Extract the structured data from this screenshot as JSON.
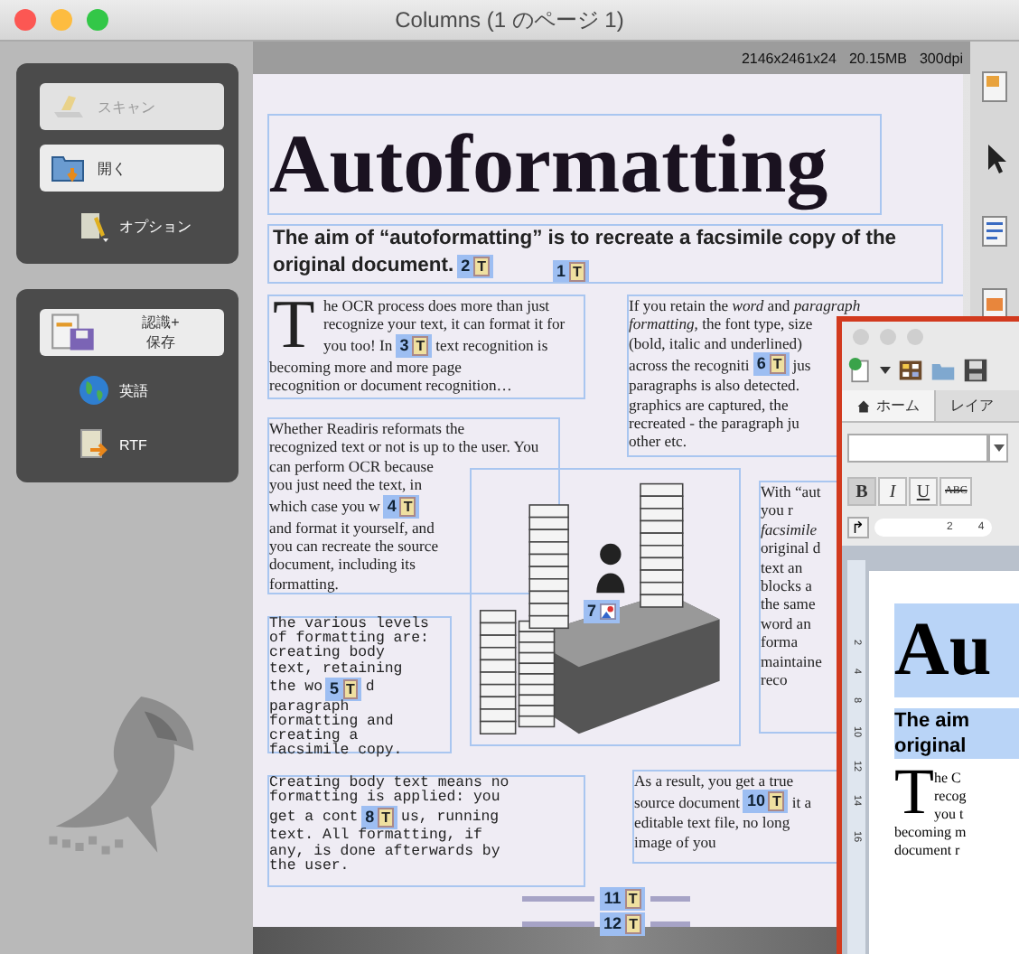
{
  "window": {
    "title": "Columns (1 のページ 1)"
  },
  "sidebar": {
    "groups": [
      {
        "items": [
          {
            "label": "スキャン",
            "kind": "button",
            "disabled": true
          },
          {
            "label": "開く",
            "kind": "button",
            "disabled": false
          },
          {
            "label": "オプション",
            "kind": "plain",
            "disabled": false
          }
        ]
      },
      {
        "items": [
          {
            "label": "認識+\n保存",
            "kind": "button",
            "disabled": false
          },
          {
            "label": "英語",
            "kind": "plain",
            "disabled": false
          },
          {
            "label": "RTF",
            "kind": "plain",
            "disabled": false
          }
        ]
      }
    ]
  },
  "status": [
    "2146x2461x24",
    "20.15MB",
    "300dpi"
  ],
  "zones": [
    {
      "kind": "heading",
      "lines": [
        {
          "text": "Autoformatting"
        }
      ],
      "label": {
        "number": "1",
        "glyph": "T"
      }
    },
    {
      "kind": "subheading",
      "lines": [
        {
          "text": "The aim of “autoformatting” is to recreate a facsimile copy of the"
        },
        {
          "text": "original document.",
          "label": true
        }
      ],
      "label": {
        "number": "2",
        "glyph": "T"
      }
    },
    {
      "kind": "paragraph",
      "dropcap": "T",
      "lines": [
        {
          "text": "he OCR process does more than just"
        },
        {
          "text": "recognize your text, it can format it for"
        },
        {
          "text": "you too! In",
          "label": true,
          "rest": "text recognition is"
        },
        {
          "text": "becoming more and more page"
        },
        {
          "text": "recognition or document recognition…"
        }
      ],
      "label": {
        "number": "3",
        "glyph": "T"
      }
    },
    {
      "kind": "paragraph",
      "lines": [
        {
          "text": "If you retain the *word* and *paragraph*"
        },
        {
          "text": "*formatting*, the font type, size"
        },
        {
          "text": "(bold, italic and underlined)"
        },
        {
          "text": "across the recogniti",
          "label": true,
          "rest": "jus"
        },
        {
          "text": "paragraphs is also detected."
        },
        {
          "text": "graphics are captured, the"
        },
        {
          "text": "recreated - the paragraph ju"
        },
        {
          "text": "other etc."
        }
      ],
      "label": {
        "number": "6",
        "glyph": "T"
      }
    },
    {
      "kind": "paragraph",
      "lines": [
        {
          "text": "Whether Readiris reformats the"
        },
        {
          "text": "recognized text or not is up to the user. You"
        },
        {
          "text": "can perform OCR because"
        },
        {
          "text": "you just need the text, in"
        },
        {
          "text": "which case you w",
          "label": true
        },
        {
          "text": "and format it yourself, and"
        },
        {
          "text": "you can recreate the source"
        },
        {
          "text": "document, including its"
        },
        {
          "text": "formatting."
        }
      ],
      "label": {
        "number": "4",
        "glyph": "T"
      }
    },
    {
      "kind": "picture",
      "label": {
        "number": "7"
      }
    },
    {
      "kind": "paragraph",
      "lines": [
        {
          "text": "With “aut"
        },
        {
          "text": "you r"
        },
        {
          "text": "*facsimile*"
        },
        {
          "text": "original d"
        },
        {
          "text": "text an"
        },
        {
          "text": "blocks a"
        },
        {
          "text": "the same"
        },
        {
          "text": "word an"
        },
        {
          "text": "forma"
        },
        {
          "text": "maintaine"
        },
        {
          "text": "reco"
        }
      ]
    },
    {
      "kind": "mono",
      "lines": [
        {
          "text": "The various levels"
        },
        {
          "text": "of formatting are:"
        },
        {
          "text": "creating body"
        },
        {
          "text": "text, retaining"
        },
        {
          "text": "the wo",
          "label": true,
          "rest": "d"
        },
        {
          "text": "paragraph"
        },
        {
          "text": "formatting and"
        },
        {
          "text": "creating a"
        },
        {
          "text": "facsimile copy."
        }
      ],
      "label": {
        "number": "5",
        "glyph": "T"
      }
    },
    {
      "kind": "mono",
      "lines": [
        {
          "text": "Creating body text means no"
        },
        {
          "text": "formatting is applied: you"
        },
        {
          "text": "get a cont",
          "label": true,
          "rest": "us, running"
        },
        {
          "text": "text. All formatting, if"
        },
        {
          "text": "any, is done afterwards by"
        },
        {
          "text": "the user."
        }
      ],
      "label": {
        "number": "8",
        "glyph": "T"
      }
    },
    {
      "kind": "paragraph",
      "lines": [
        {
          "text": "As a result, you get a true"
        },
        {
          "text": "source document",
          "label": true,
          "rest": "it a"
        },
        {
          "text": "editable text file, no long"
        },
        {
          "text": "image of you"
        }
      ],
      "label": {
        "number": "10",
        "glyph": "T"
      }
    },
    {
      "kind": "footer",
      "labels": [
        {
          "number": "11",
          "glyph": "T"
        },
        {
          "number": "12",
          "glyph": "T"
        }
      ]
    }
  ],
  "editor": {
    "tabs": [
      {
        "label": "ホーム",
        "selected": true
      },
      {
        "label": "レイア",
        "selected": false
      }
    ],
    "format_buttons": [
      "B",
      "I",
      "U",
      "ABC"
    ],
    "tab_selector": "↱",
    "ruler": [
      "2",
      "4"
    ],
    "vertical_ruler": [
      "2",
      "4",
      "8",
      "10",
      "12",
      "14",
      "16"
    ],
    "heading": "Au",
    "subheading": [
      "The aim",
      "original"
    ],
    "dropcap": "T",
    "lines": [
      "he C",
      "recog",
      "you t",
      "becoming m",
      "document r"
    ]
  }
}
